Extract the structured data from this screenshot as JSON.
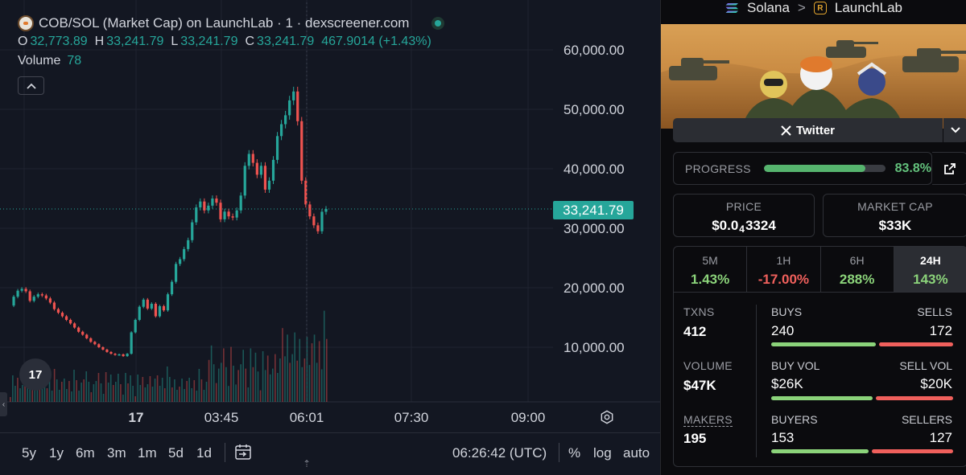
{
  "chart": {
    "pair_title": "COB/SOL (Market Cap) on LaunchLab · 1 · dexscreener.com",
    "ohlc": {
      "o_label": "O",
      "o": "32,773.89",
      "h_label": "H",
      "h": "33,241.79",
      "l_label": "L",
      "l": "33,241.79",
      "c_label": "C",
      "c": "33,241.79",
      "change": "467.9014 (+1.43%)"
    },
    "volume_label": "Volume",
    "volume_value": "78",
    "collapse_icon": "chevron-up-icon",
    "y_tick_labels": [
      "60,000.00",
      "50,000.00",
      "40,000.00",
      "30,000.00",
      "20,000.00",
      "10,000.00"
    ],
    "current_price_label": "33,241.79",
    "x_tick_labels": [
      "17",
      "03:45",
      "06:01",
      "07:30",
      "09:00"
    ],
    "tv_logo": "17",
    "ranges": [
      "5y",
      "1y",
      "6m",
      "3m",
      "1m",
      "5d",
      "1d"
    ],
    "clock": "06:26:42 (UTC)",
    "options": {
      "percent": "%",
      "log": "log",
      "auto": "auto"
    },
    "colors": {
      "up": "#26a69a",
      "down": "#ef5350",
      "bg": "#131722"
    }
  },
  "chart_data": {
    "type": "candlestick",
    "title": "COB/SOL (Market Cap) on LaunchLab · 1 · dexscreener.com",
    "ylim": [
      0,
      62000
    ],
    "y_ticks": [
      10000,
      20000,
      30000,
      40000,
      50000,
      60000
    ],
    "x_ticks": [
      "17",
      "03:45",
      "06:01",
      "07:30",
      "09:00"
    ],
    "current_value": 33241.79,
    "close_series": [
      17000,
      18500,
      19500,
      19800,
      19400,
      17800,
      18500,
      18900,
      18700,
      18200,
      17500,
      16400,
      15800,
      15200,
      14600,
      14000,
      13300,
      12600,
      12100,
      11500,
      10900,
      10500,
      10000,
      9600,
      9200,
      8900,
      8700,
      8800,
      8500,
      8900,
      12500,
      14600,
      16800,
      18000,
      16500,
      17300,
      15200,
      16900,
      16200,
      18900,
      21000,
      24000,
      24800,
      26500,
      28000,
      31000,
      33500,
      34500,
      33000,
      33800,
      35000,
      34300,
      31500,
      32800,
      32000,
      31800,
      33000,
      35500,
      40500,
      42500,
      41000,
      39000,
      40500,
      36500,
      38000,
      41500,
      45500,
      47500,
      49000,
      51500,
      53000,
      48000,
      38000,
      34000,
      32000,
      30500,
      29500,
      32773.89,
      33241.79
    ]
  },
  "sidebar": {
    "breadcrumb": {
      "chain": "Solana",
      "sep": ">",
      "launchpad": "LaunchLab"
    },
    "twitter_label": "Twitter",
    "progress": {
      "label": "PROGRESS",
      "value": "83.8%",
      "fraction": 0.838
    },
    "price": {
      "label": "PRICE",
      "prefix": "$0.0",
      "zeros": "4",
      "digits": "3324"
    },
    "market_cap": {
      "label": "MARKET CAP",
      "value": "$33K"
    },
    "timeframes": [
      {
        "label": "5M",
        "value": "1.43%",
        "tone": "green"
      },
      {
        "label": "1H",
        "value": "-17.00%",
        "tone": "red"
      },
      {
        "label": "6H",
        "value": "288%",
        "tone": "green"
      },
      {
        "label": "24H",
        "value": "143%",
        "tone": "green"
      }
    ],
    "txns": {
      "label": "TXNS",
      "value": "412",
      "buys_label": "BUYS",
      "buys": "240",
      "sells_label": "SELLS",
      "sells": "172",
      "buy_fraction": 0.583
    },
    "volume": {
      "label": "VOLUME",
      "value": "$47K",
      "buys_label": "BUY VOL",
      "buys": "$26K",
      "sells_label": "SELL VOL",
      "sells": "$20K",
      "buy_fraction": 0.565
    },
    "makers": {
      "label": "MAKERS",
      "value": "195",
      "buys_label": "BUYERS",
      "buys": "153",
      "sells_label": "SELLERS",
      "sells": "127",
      "buy_fraction": 0.546
    }
  }
}
